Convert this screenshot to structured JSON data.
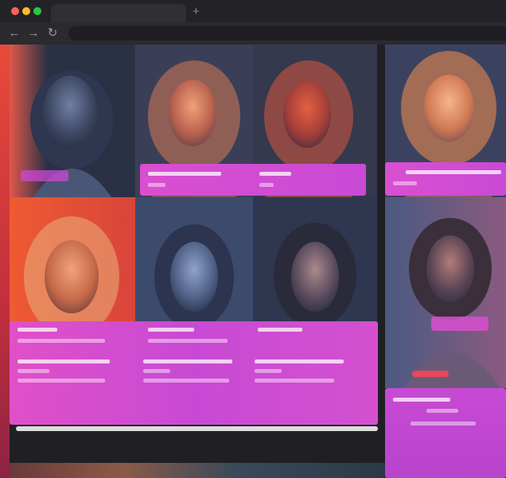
{
  "browser": {
    "new_tab_label": "+",
    "nav": {
      "back_label": "←",
      "forward_label": "→",
      "reload_label": "↻"
    }
  },
  "colors": {
    "caption_pink": "#d94fd0",
    "accent_red": "#e84a3a",
    "panel_dark": "#2b2d3a"
  },
  "gallery": {
    "tiles": [
      {
        "id": "portrait-1",
        "tone": "cool-blue"
      },
      {
        "id": "portrait-2",
        "tone": "warm-orange"
      },
      {
        "id": "portrait-3",
        "tone": "red-orange"
      },
      {
        "id": "portrait-4",
        "tone": "warm-peach"
      },
      {
        "id": "portrait-5",
        "tone": "orange-red"
      },
      {
        "id": "portrait-6",
        "tone": "cool-blue"
      },
      {
        "id": "portrait-7",
        "tone": "cool-blue"
      },
      {
        "id": "portrait-8",
        "tone": "blue-pink"
      }
    ]
  }
}
